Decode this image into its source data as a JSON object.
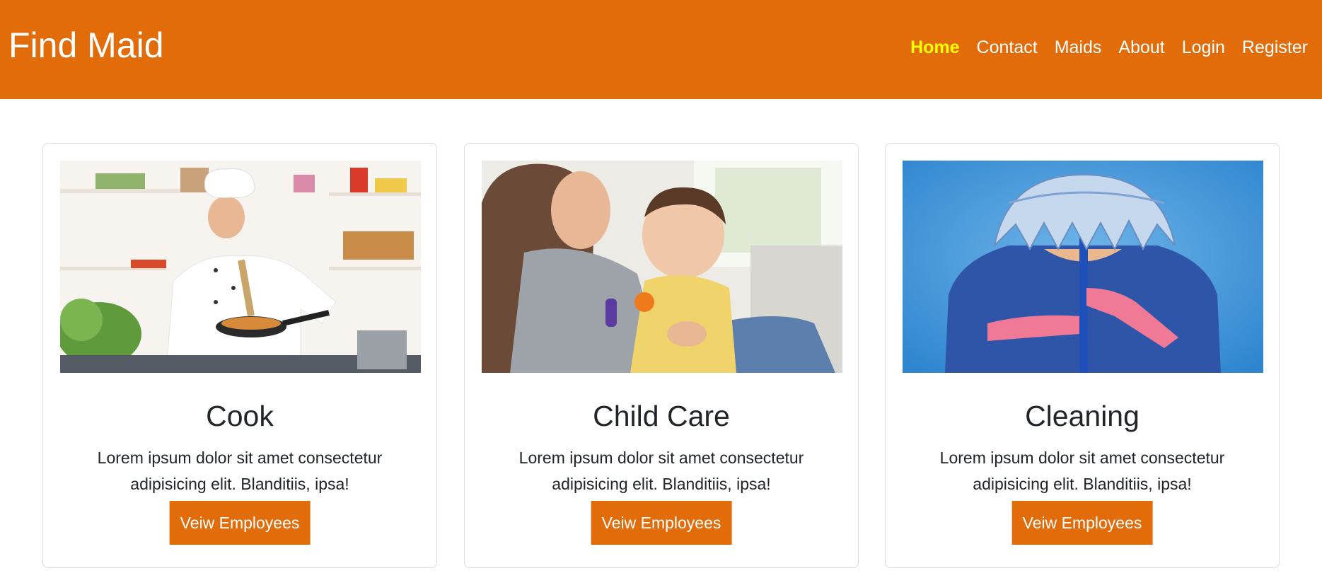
{
  "brand": "Find Maid",
  "nav": [
    {
      "label": "Home",
      "active": true
    },
    {
      "label": "Contact"
    },
    {
      "label": "Maids"
    },
    {
      "label": "About"
    },
    {
      "label": "Login"
    },
    {
      "label": "Register"
    }
  ],
  "cards": [
    {
      "title": "Cook",
      "text": "Lorem ipsum dolor sit amet consectetur adipisicing elit. Blanditiis, ipsa!",
      "button": "Veiw Employees",
      "image": "chef-cooking-photo"
    },
    {
      "title": "Child Care",
      "text": "Lorem ipsum dolor sit amet consectetur adipisicing elit. Blanditiis, ipsa!",
      "button": "Veiw Employees",
      "image": "mother-with-baby-photo"
    },
    {
      "title": "Cleaning",
      "text": "Lorem ipsum dolor sit amet consectetur adipisicing elit. Blanditiis, ipsa!",
      "button": "Veiw Employees",
      "image": "woman-holding-mop-photo"
    }
  ],
  "colors": {
    "primary": "#e36c0a",
    "active_nav": "#ffff00"
  }
}
